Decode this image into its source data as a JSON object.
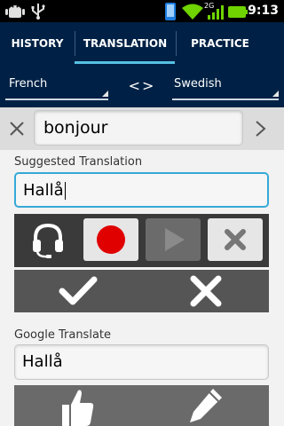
{
  "status_bar": {
    "time": "9:13",
    "network": "2G",
    "icons": [
      "android-debug-icon",
      "usb-icon",
      "phone-icon",
      "wifi-icon",
      "signal-icon",
      "battery-icon"
    ]
  },
  "tabs": [
    {
      "label": "HISTORY",
      "selected": false
    },
    {
      "label": "TRANSLATION",
      "selected": true
    },
    {
      "label": "PRACTICE",
      "selected": false
    }
  ],
  "languages": {
    "source": "French",
    "target": "Swedish",
    "swap_label": "<>"
  },
  "search": {
    "value": "bonjour"
  },
  "suggested": {
    "label": "Suggested Translation",
    "value": "Hallå"
  },
  "google": {
    "label": "Google Translate",
    "value": "Hallå"
  },
  "icons": {
    "clear": "close-icon",
    "next": "chevron-right-icon",
    "headset": "headset-icon",
    "record": "record-icon",
    "play": "play-icon",
    "delete": "delete-icon",
    "accept": "checkmark-icon",
    "reject": "cross-icon",
    "thumbs_up": "thumbs-up-icon",
    "edit": "pencil-icon"
  },
  "colors": {
    "header_bg": "#002145",
    "tab_indicator": "#56c0e3",
    "focus_border": "#36a9d8",
    "record_red": "#e00000"
  }
}
